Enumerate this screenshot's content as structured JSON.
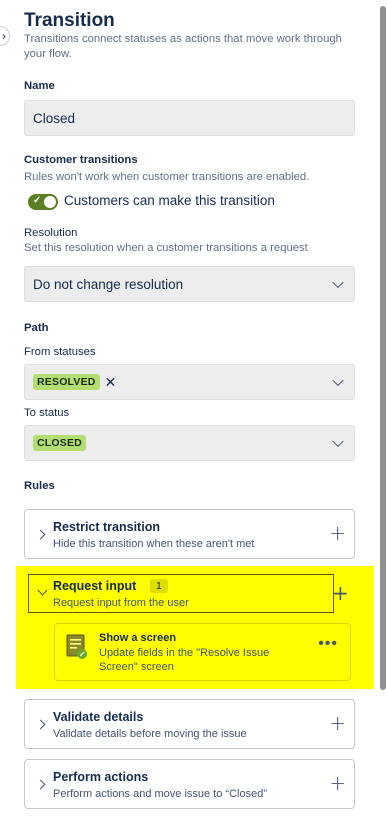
{
  "header": {
    "title": "Transition",
    "description": "Transitions connect statuses as actions that move work through your flow."
  },
  "name_section": {
    "label": "Name",
    "value": "Closed"
  },
  "customer_transitions": {
    "label": "Customer transitions",
    "help": "Rules won't work when customer transitions are enabled.",
    "toggle_label": "Customers can make this transition",
    "toggle_on": true,
    "toggle_color": "#5b7f24"
  },
  "resolution": {
    "label": "Resolution",
    "help": "Set this resolution when a customer transitions a request",
    "selected": "Do not change resolution"
  },
  "path": {
    "label": "Path",
    "from_label": "From statuses",
    "from_values": [
      "RESOLVED"
    ],
    "to_label": "To status",
    "to_value": "CLOSED",
    "lozenge_color": "#b3df72"
  },
  "rules": {
    "label": "Rules",
    "items": [
      {
        "title": "Restrict transition",
        "description": "Hide this transition when these aren't met"
      },
      {
        "title": "Request input",
        "count": "1",
        "description": "Request input from the user"
      },
      {
        "title": "Validate details",
        "description": "Validate details before moving the issue"
      },
      {
        "title": "Perform actions",
        "description": "Perform actions and move issue to “Closed”"
      }
    ],
    "request_input_children": [
      {
        "title": "Show a screen",
        "description": "Update fields in the \"Resolve Issue Screen\" screen"
      }
    ]
  },
  "highlight_color": "#ffff00"
}
